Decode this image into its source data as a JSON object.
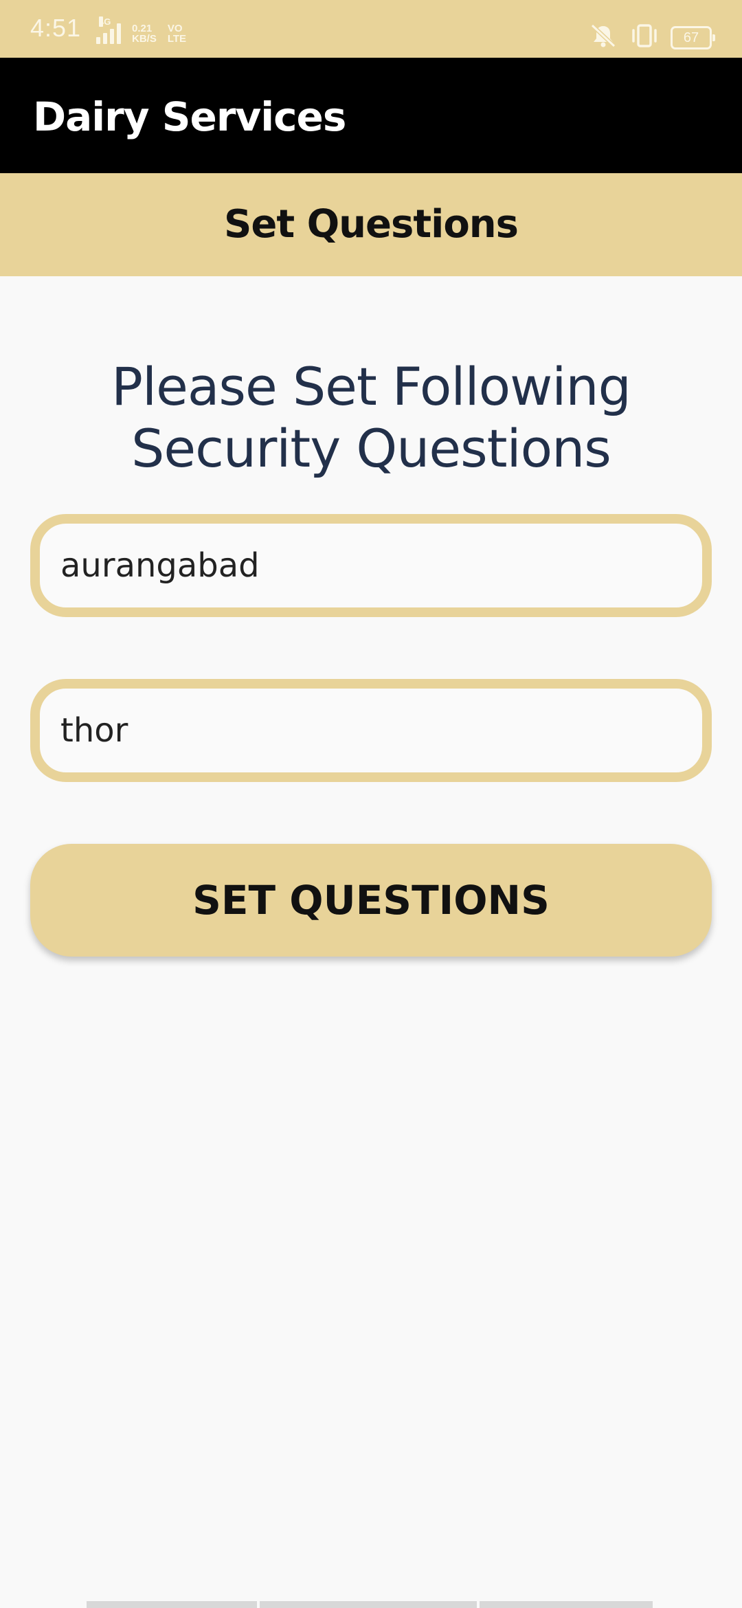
{
  "status_bar": {
    "time": "4:51",
    "network_type": "4G",
    "speed_value": "0.21",
    "speed_unit": "KB/S",
    "volte_top": "VO",
    "volte_bottom": "LTE",
    "battery": "67",
    "icons": [
      "signal-icon",
      "mute-icon",
      "vibrate-icon",
      "battery-icon"
    ]
  },
  "app_bar": {
    "title": "Dairy Services"
  },
  "section_header": {
    "title": "Set Questions"
  },
  "form": {
    "instructions": "Please Set Following Security Questions",
    "answer_1": "aurangabad",
    "answer_2": "thor",
    "submit_label": "SET QUESTIONS"
  },
  "colors": {
    "accent": "#e8d399",
    "app_bar_bg": "#000000",
    "text_dark": "#22304a",
    "background": "#f9f9f9"
  }
}
